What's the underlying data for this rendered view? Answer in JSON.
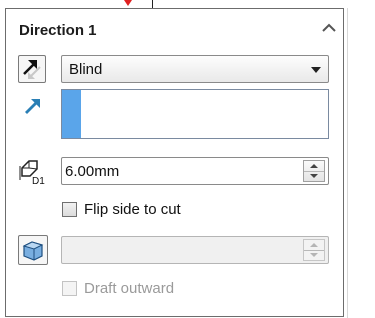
{
  "header": {
    "title": "Direction 1"
  },
  "end_condition": {
    "selected": "Blind"
  },
  "depth": {
    "value": "6.00mm",
    "icon_label": "D1"
  },
  "flip_side": {
    "label": "Flip side to cut",
    "checked": false
  },
  "draft": {
    "value": "",
    "outward_label": "Draft outward",
    "outward_checked": false,
    "enabled": false
  },
  "colors": {
    "accent": "#5aa5ea",
    "arrow_icon": "#2a7fb5",
    "red_marker": "#e02020"
  }
}
